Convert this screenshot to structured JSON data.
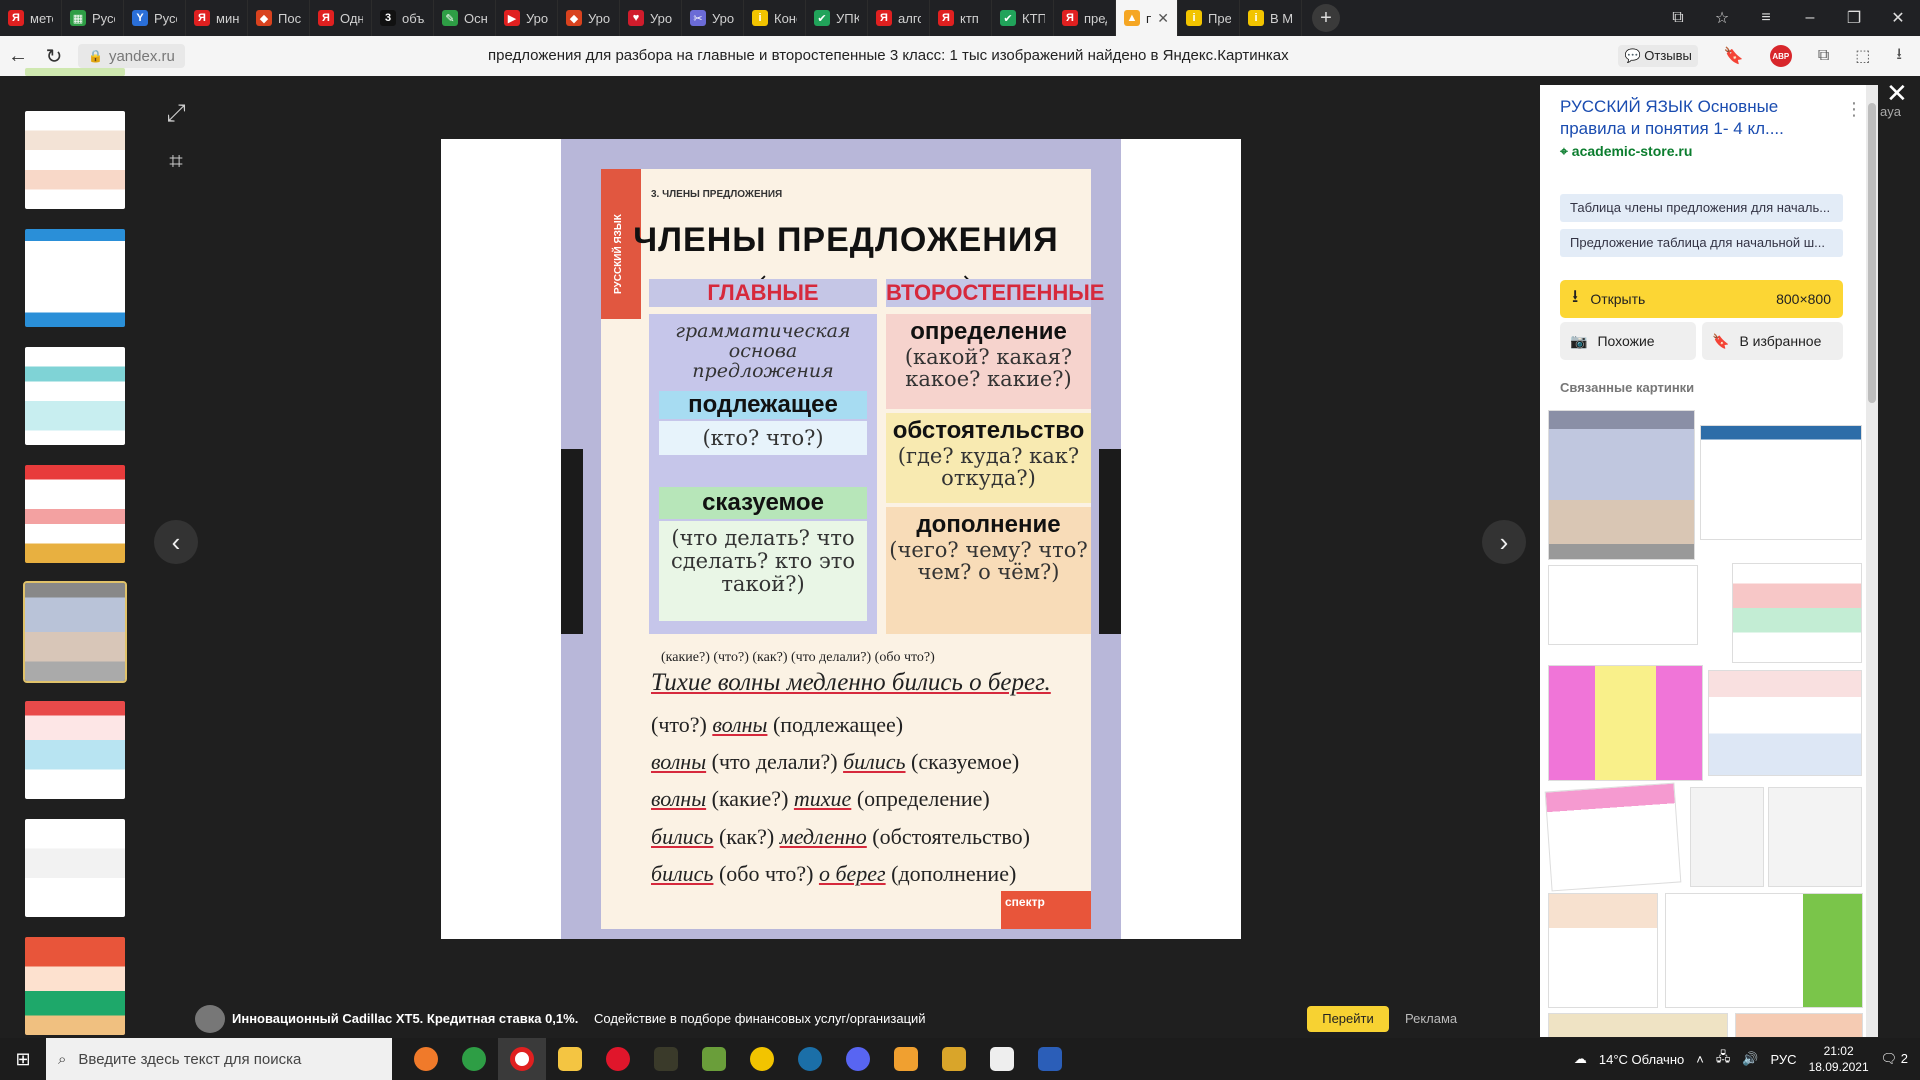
{
  "tabs": [
    {
      "label": "мето",
      "color": "#e02020",
      "glyph": "Я"
    },
    {
      "label": "Русск",
      "color": "#2e9e45",
      "glyph": "▦"
    },
    {
      "label": "Русск",
      "color": "#2a6fd8",
      "glyph": "Y"
    },
    {
      "label": "мину",
      "color": "#e02020",
      "glyph": "Я"
    },
    {
      "label": "Посл",
      "color": "#d9421e",
      "glyph": "◆"
    },
    {
      "label": "Одна",
      "color": "#e02020",
      "glyph": "Я"
    },
    {
      "label": "объя",
      "color": "#111111",
      "glyph": "3"
    },
    {
      "label": "Осно",
      "color": "#2e9e45",
      "glyph": "✎"
    },
    {
      "label": "Урок",
      "color": "#e02020",
      "glyph": "▶"
    },
    {
      "label": "Урок",
      "color": "#d9421e",
      "glyph": "◆"
    },
    {
      "label": "Урок",
      "color": "#d01c2c",
      "glyph": "♥"
    },
    {
      "label": "Урок",
      "color": "#6b6bd6",
      "glyph": "✂"
    },
    {
      "label": "Конс",
      "color": "#f2c400",
      "glyph": "i"
    },
    {
      "label": "УПК",
      "color": "#21a35a",
      "glyph": "✔"
    },
    {
      "label": "алгор",
      "color": "#e02020",
      "glyph": "Я"
    },
    {
      "label": "ктп р",
      "color": "#e02020",
      "glyph": "Я"
    },
    {
      "label": "КТП",
      "color": "#21a35a",
      "glyph": "✔"
    },
    {
      "label": "пред",
      "color": "#e02020",
      "glyph": "Я"
    },
    {
      "label": "пр",
      "color": "#f5a623",
      "glyph": "▲",
      "active": true
    },
    {
      "label": "Пред",
      "color": "#f2c400",
      "glyph": "i"
    },
    {
      "label": "В Ми",
      "color": "#f2c400",
      "glyph": "i"
    }
  ],
  "address": {
    "url": "yandex.ru",
    "page_title": "предложения для разбора на главные и второстепенные 3 класс: 1 тыс изображений найдено в Яндекс.Картинках",
    "reviews": "Отзывы",
    "abp": "ABP"
  },
  "poster": {
    "small_header": "3. ЧЛЕНЫ ПРЕДЛОЖЕНИЯ",
    "spine": "РУССКИЙ ЯЗЫК",
    "title": "ЧЛЕНЫ  ПРЕДЛОЖЕНИЯ",
    "main_head": "ГЛАВНЫЕ",
    "secondary_head": "ВТОРОСТЕПЕННЫЕ",
    "gram_basis": "грамматическая основа предложения",
    "subject": "подлежащее",
    "subject_q": "(кто? что?)",
    "predicate": "сказуемое",
    "predicate_q": "(что делать? что сделать? кто это такой?)",
    "attribute": "определение",
    "attribute_q": "(какой? какая? какое? какие?)",
    "adverbial": "обстоятельство",
    "adverbial_q": "(где? куда? как? откуда?)",
    "object": "дополнение",
    "object_q": "(чего? чему? что? чем? о чём?)",
    "questions_line": "(какие?)  (что?)    (как?)   (что делали?) (обо что?)",
    "example": "Тихие волны медленно бились о берег.",
    "ex1_q": "(что?)",
    "ex1_w": "волны",
    "ex1_r": "(подлежащее)",
    "ex2_w1": "волны",
    "ex2_q": "(что делали?)",
    "ex2_w2": "бились",
    "ex2_r": "(сказуемое)",
    "ex3_w1": "волны",
    "ex3_q": "(какие?)",
    "ex3_w2": "тихие",
    "ex3_r": "(определение)",
    "ex4_w1": "бились",
    "ex4_q": "(как?)",
    "ex4_w2": "медленно",
    "ex4_r": "(обстоятельство)",
    "ex5_w1": "бились",
    "ex5_q": "(обо что?)",
    "ex5_w2": "о берег",
    "ex5_r": "(дополнение)",
    "brand": "спектр"
  },
  "ad": {
    "title": "Инновационный Cadillac XT5. Кредитная ставка 0,1%.",
    "desc": "Содействие в подборе финансовых услуг/организаций",
    "button": "Перейти",
    "label": "Реклама"
  },
  "side": {
    "title": "РУССКИЙ ЯЗЫК Основные правила и понятия 1- 4 кл....",
    "source": "academic-store.ru",
    "chip1": "Таблица члены предложения для началь...",
    "chip2": "Предложение таблица для начальной ш...",
    "open": "Открыть",
    "size": "800×800",
    "similar": "Похожие",
    "favorite": "В избранное",
    "related": "Связанные картинки",
    "cut_text": "aya"
  },
  "taskbar": {
    "search_placeholder": "Введите здесь текст для поиска",
    "weather": "14°C  Облачно",
    "lang": "РУС",
    "time": "21:02",
    "date": "18.09.2021",
    "notif": "2"
  }
}
